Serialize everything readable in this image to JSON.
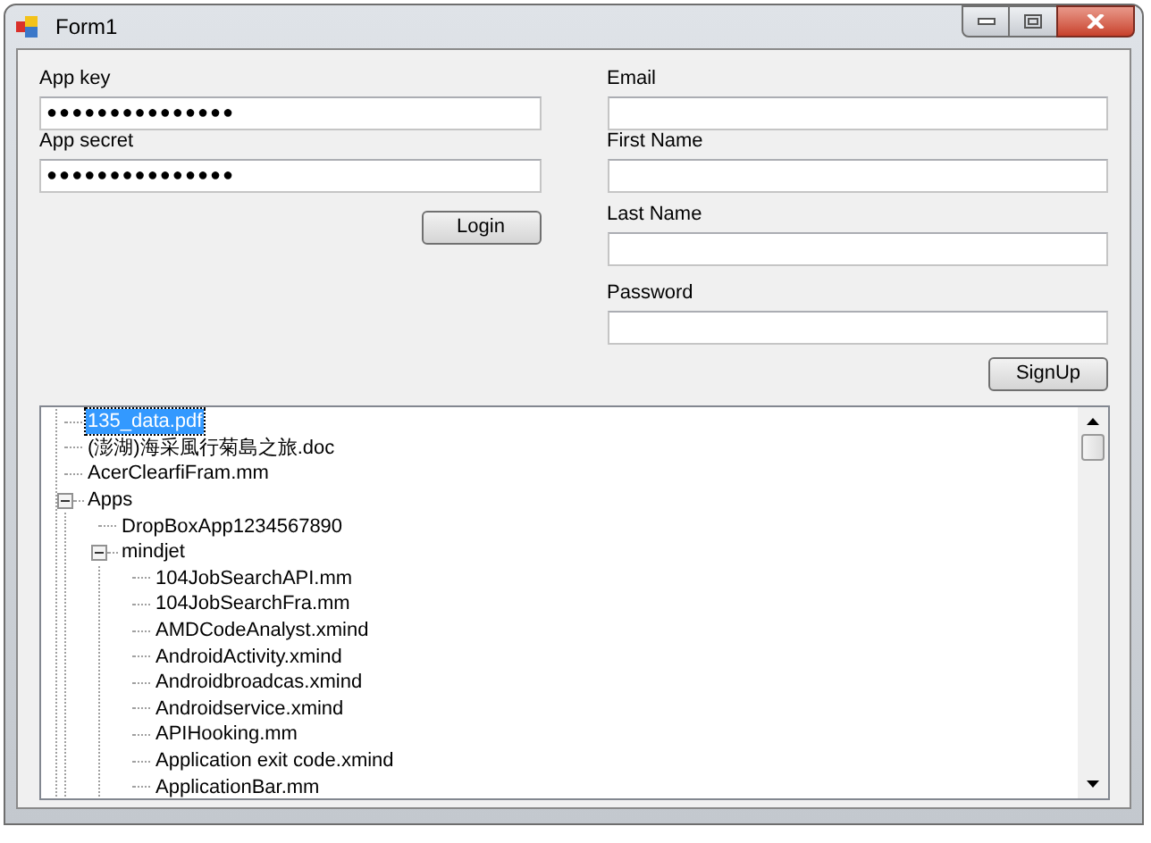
{
  "window": {
    "title": "Form1"
  },
  "left_fields": [
    {
      "label": "App key",
      "value": "●●●●●●●●●●●●●●●"
    },
    {
      "label": "App secret",
      "value": "●●●●●●●●●●●●●●●"
    }
  ],
  "login_button": "Login",
  "right_fields": [
    {
      "label": "Email"
    },
    {
      "label": "First Name"
    },
    {
      "label": "Last Name"
    },
    {
      "label": "Password"
    }
  ],
  "signup_button": "SignUp",
  "tree": [
    {
      "label": "135_data.pdf",
      "selected": true
    },
    {
      "label": "(澎湖)海采風行菊島之旅.doc",
      "selected": false
    },
    {
      "label": "AcerClearfiFram.mm",
      "selected": false
    },
    {
      "label": "Apps",
      "selected": false,
      "expanded": true,
      "children": [
        {
          "label": "DropBoxApp1234567890",
          "selected": false
        },
        {
          "label": "mindjet",
          "selected": false,
          "expanded": true,
          "children": [
            {
              "label": "104JobSearchAPI.mm",
              "selected": false
            },
            {
              "label": "104JobSearchFra.mm",
              "selected": false
            },
            {
              "label": "AMDCodeAnalyst.xmind",
              "selected": false
            },
            {
              "label": "AndroidActivity.xmind",
              "selected": false
            },
            {
              "label": "Androidbroadcas.xmind",
              "selected": false
            },
            {
              "label": "Androidservice.xmind",
              "selected": false
            },
            {
              "label": "APIHooking.mm",
              "selected": false
            },
            {
              "label": "Application exit code.xmind",
              "selected": false
            },
            {
              "label": "ApplicationBar.mm",
              "selected": false
            }
          ]
        }
      ]
    }
  ]
}
